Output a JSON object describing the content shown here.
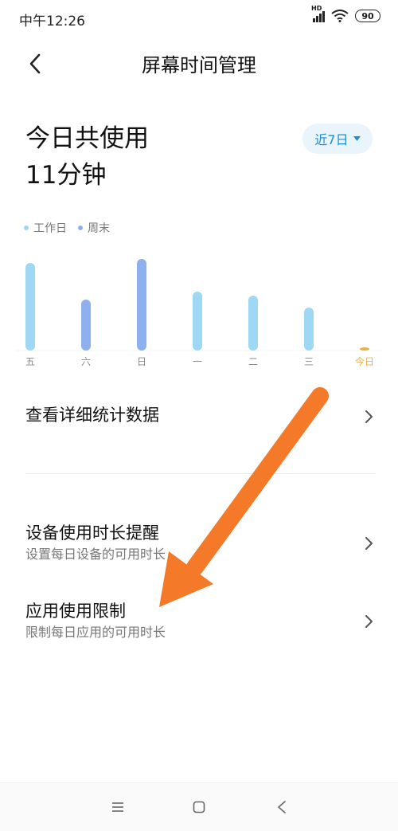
{
  "status": {
    "time": "中午12:26",
    "network": "HD",
    "battery": "90"
  },
  "header": {
    "title": "屏幕时间管理",
    "back_icon": "chevron-left-icon"
  },
  "summary": {
    "title": "今日共使用",
    "value": "11分钟"
  },
  "range_select": {
    "label": "近7日",
    "icon": "caret-down-icon"
  },
  "legend": [
    {
      "label": "工作日",
      "color": "#9fd8f5"
    },
    {
      "label": "周末",
      "color": "#8fb0ee"
    }
  ],
  "colors": {
    "accent": "#1a8fd1",
    "today": "#e8b24a",
    "arrow": "#f47a2a"
  },
  "chart_data": {
    "type": "bar",
    "categories": [
      "五",
      "六",
      "日",
      "一",
      "二",
      "三",
      "今日"
    ],
    "values": [
      110,
      64,
      115,
      74,
      69,
      54,
      3
    ],
    "kinds": [
      "workday",
      "weekend",
      "weekend",
      "workday",
      "workday",
      "workday",
      "today"
    ],
    "ylim": [
      0,
      120
    ],
    "grid": false,
    "legend_position": "top-left"
  },
  "rows": {
    "detail_stats": {
      "title": "查看详细统计数据"
    },
    "device_reminder": {
      "title": "设备使用时长提醒",
      "subtitle": "设置每日设备的可用时长"
    },
    "app_limit": {
      "title": "应用使用限制",
      "subtitle": "限制每日应用的可用时长"
    }
  },
  "nav": {
    "menu_icon": "menu-icon",
    "home_icon": "home-square-icon",
    "back_icon": "back-triangle-icon"
  }
}
